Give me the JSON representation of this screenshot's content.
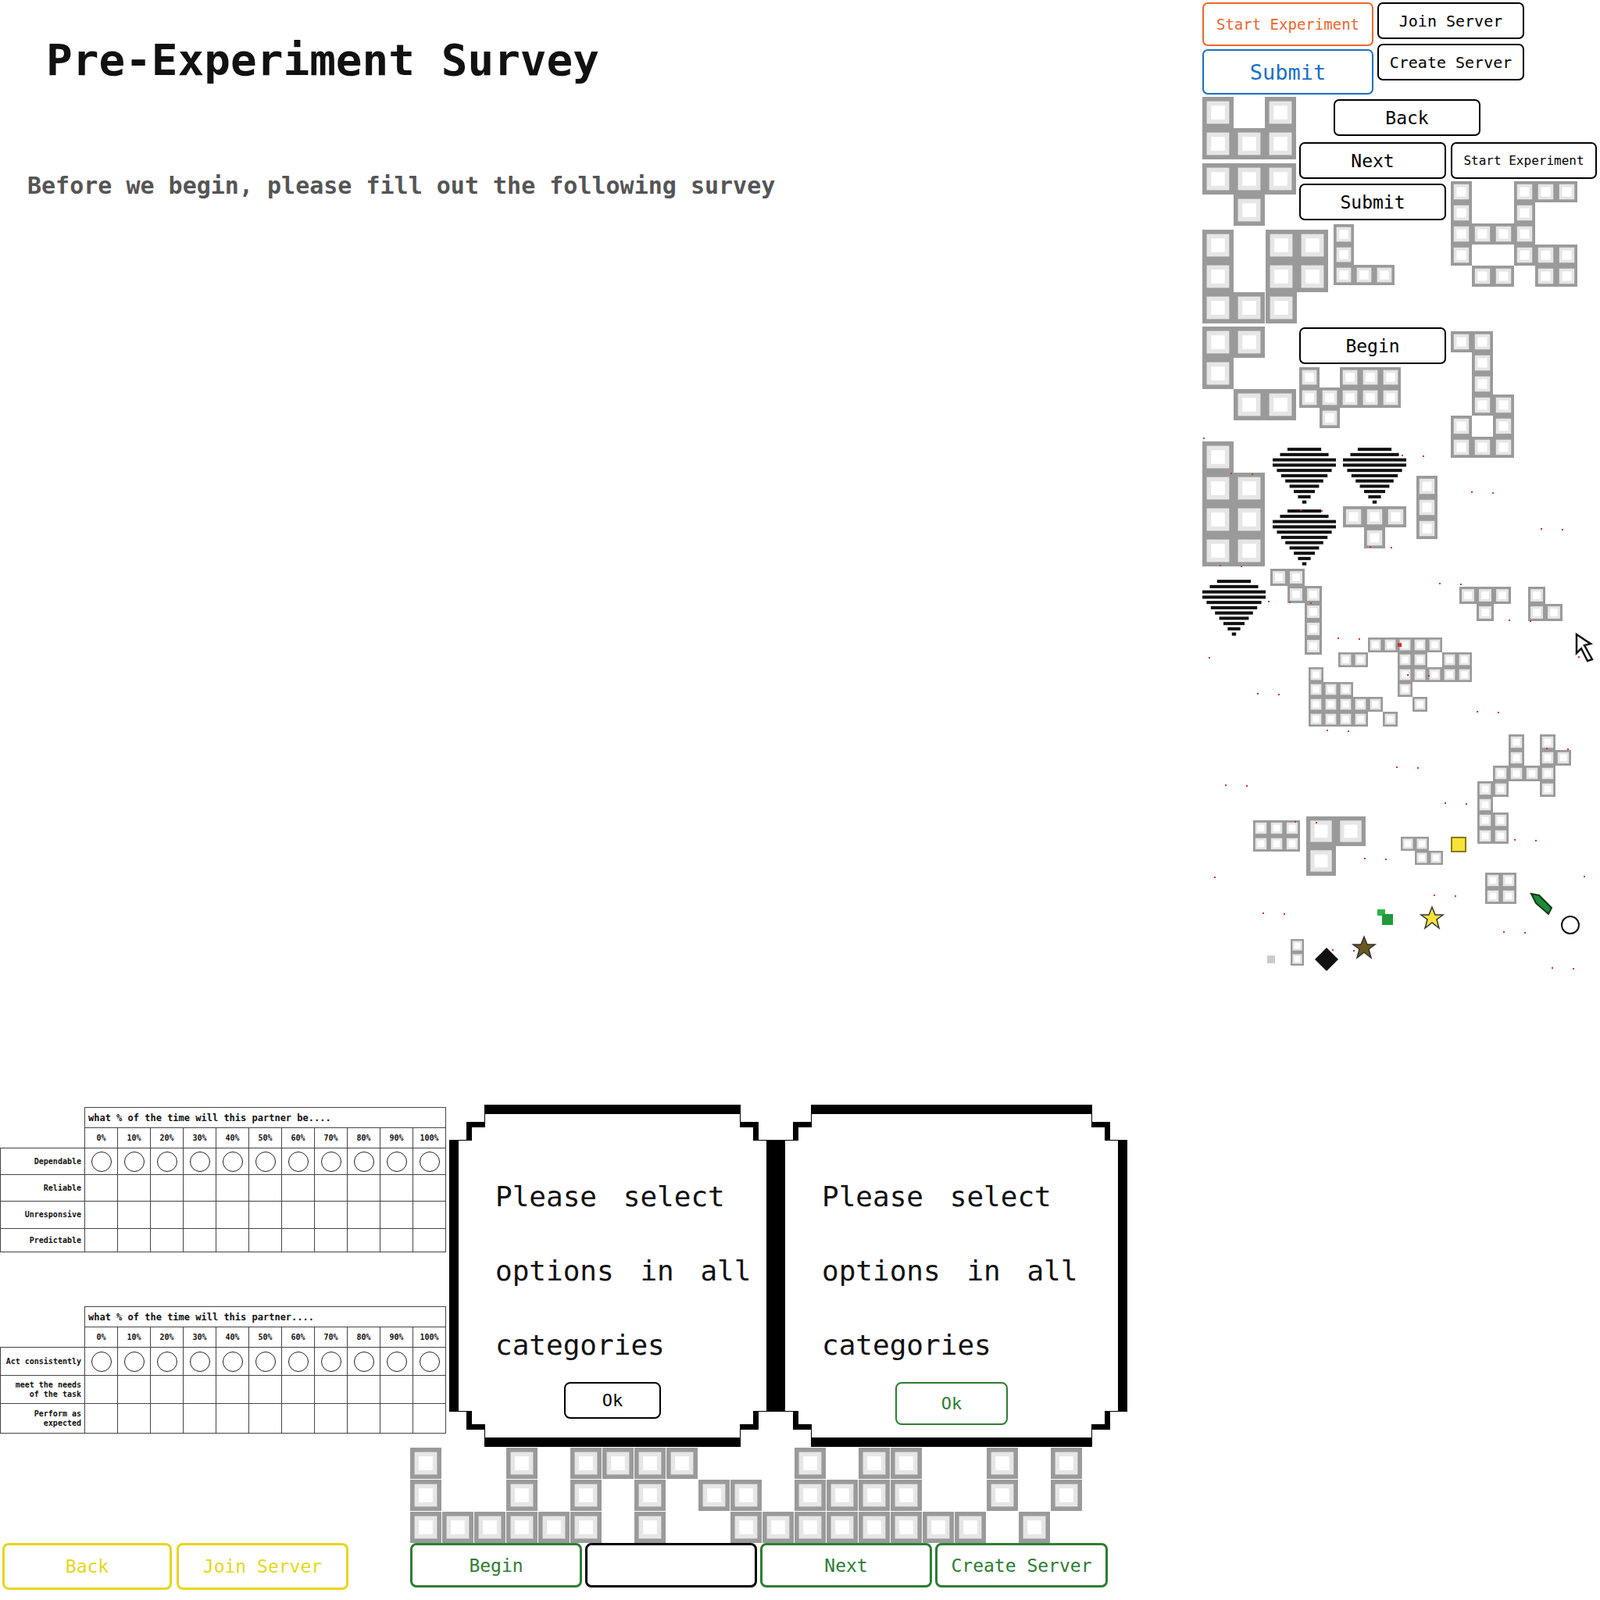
{
  "title": "Pre-Experiment Survey",
  "subtitle": "Before we begin, please fill out the following survey",
  "spriteButtons": [
    {
      "label": "Start Experiment",
      "color": "#e8672e"
    },
    {
      "label": "Join Server",
      "color": "#000000"
    },
    {
      "label": "Submit",
      "color": "#1b6fc4"
    },
    {
      "label": "Create Server",
      "color": "#000000"
    },
    {
      "label": "Back",
      "color": "#000000"
    },
    {
      "label": "Next",
      "color": "#000000"
    },
    {
      "label": "Start Experiment",
      "color": "#000000"
    },
    {
      "label": "Submit",
      "color": "#000000"
    },
    {
      "label": "Begin",
      "color": "#000000"
    }
  ],
  "surveyTables": [
    {
      "header": "what % of the time will this partner be....",
      "columns": [
        "0%",
        "10%",
        "20%",
        "30%",
        "40%",
        "50%",
        "60%",
        "70%",
        "80%",
        "90%",
        "100%"
      ],
      "rows": [
        {
          "label": "Dependable",
          "kind": "radio"
        },
        {
          "label": "Reliable",
          "kind": "blank"
        },
        {
          "label": "Unresponsive",
          "kind": "blank"
        },
        {
          "label": "Predictable",
          "kind": "blank"
        }
      ]
    },
    {
      "header": "what % of the time will this partner....",
      "columns": [
        "0%",
        "10%",
        "20%",
        "30%",
        "40%",
        "50%",
        "60%",
        "70%",
        "80%",
        "90%",
        "100%"
      ],
      "rows": [
        {
          "label": "Act consistently",
          "kind": "radio"
        },
        {
          "label": "meet the needs of the task",
          "kind": "blank"
        },
        {
          "label": "Perform as expected",
          "kind": "blank"
        }
      ]
    }
  ],
  "dialogs": [
    {
      "message": "Please select options in all categories",
      "button": "Ok",
      "color": "#000000"
    },
    {
      "message": "Please select options in all categories",
      "button": "Ok",
      "color": "#2e7d32"
    }
  ],
  "leftButtons": [
    {
      "label": "Back",
      "color": "#e6d619"
    },
    {
      "label": "Join Server",
      "color": "#e6d619"
    }
  ],
  "rightButtons": [
    {
      "label": "Begin",
      "color": "#2e7d32"
    },
    {
      "label": "",
      "color": "#000000"
    },
    {
      "label": "Next",
      "color": "#2e7d32"
    },
    {
      "label": "Create Server",
      "color": "#2e7d32"
    }
  ]
}
